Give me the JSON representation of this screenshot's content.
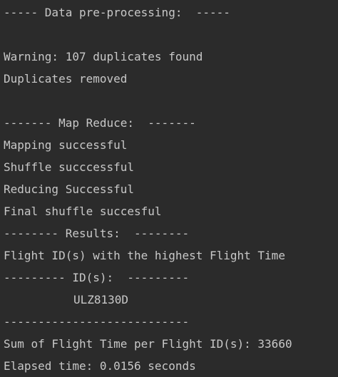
{
  "console": {
    "lines": [
      "----- Data pre-processing:  -----",
      "",
      "Warning: 107 duplicates found",
      "Duplicates removed",
      "",
      "------- Map Reduce:  -------",
      "Mapping successful",
      "Shuffle succcessful",
      "Reducing Successful",
      "Final shuffle succesful",
      "-------- Results:  --------",
      "Flight ID(s) with the highest Flight Time",
      "--------- ID(s):  ---------",
      "ULZ8130D",
      "---------------------------",
      "Sum of Flight Time per Flight ID(s): 33660",
      "Elapsed time: 0.0156 seconds"
    ]
  }
}
